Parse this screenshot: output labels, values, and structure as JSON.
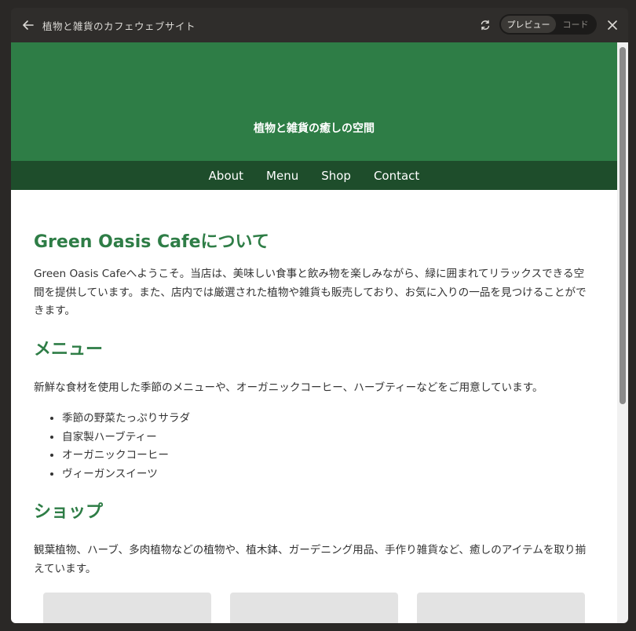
{
  "window": {
    "title": "植物と雑貨のカフェウェブサイト",
    "toggle": {
      "preview_label": "プレビュー",
      "code_label": "コード"
    }
  },
  "site": {
    "hero_tagline": "植物と雑貨の癒しの空間",
    "nav": [
      "About",
      "Menu",
      "Shop",
      "Contact"
    ],
    "about": {
      "heading": "Green Oasis Cafeについて",
      "text": "Green Oasis Cafeへようこそ。当店は、美味しい食事と飲み物を楽しみながら、緑に囲まれてリラックスできる空間を提供しています。また、店内では厳選された植物や雑貨も販売しており、お気に入りの一品を見つけることができます。"
    },
    "menu": {
      "heading": "メニュー",
      "text": "新鮮な食材を使用した季節のメニューや、オーガニックコーヒー、ハーブティーなどをご用意しています。",
      "items": [
        "季節の野菜たっぷりサラダ",
        "自家製ハーブティー",
        "オーガニックコーヒー",
        "ヴィーガンスイーツ"
      ]
    },
    "shop": {
      "heading": "ショップ",
      "text": "観葉植物、ハーブ、多肉植物などの植物や、植木鉢、ガーデニング用品、手作り雑貨など、癒しのアイテムを取り揃えています。",
      "placeholders": [
        "300",
        "300",
        "300"
      ]
    }
  },
  "colors": {
    "brand_green": "#2e7d46",
    "nav_green": "#1e4d2b"
  },
  "icons": {
    "back": "arrow-left-icon",
    "refresh": "refresh-icon",
    "close": "close-icon"
  }
}
